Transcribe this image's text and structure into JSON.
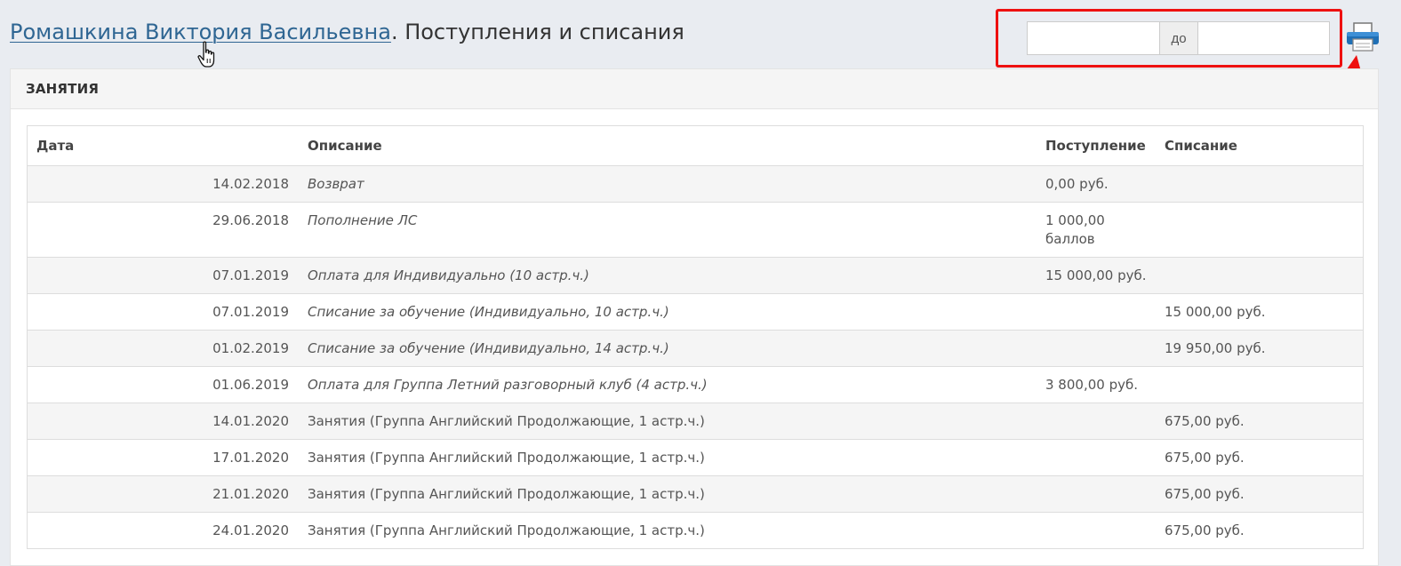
{
  "header": {
    "student_name": "Ромашкина Виктория Васильевна",
    "suffix": ". Поступления и списания"
  },
  "date_filter": {
    "from_value": "",
    "separator": "до",
    "to_value": ""
  },
  "icons": {
    "print": "printer-icon",
    "cursor": "hand-pointer-icon"
  },
  "colors": {
    "link": "#2f6693",
    "highlight": "#ee1010",
    "accent": "#1f6fb5"
  },
  "panel": {
    "title": "ЗАНЯТИЯ"
  },
  "table": {
    "columns": [
      "Дата",
      "Описание",
      "Поступление",
      "Списание"
    ],
    "rows": [
      {
        "date": "14.02.2018",
        "desc": "Возврат",
        "italic": true,
        "income": "0,00 руб.",
        "expense": ""
      },
      {
        "date": "29.06.2018",
        "desc": "Пополнение ЛС",
        "italic": true,
        "income": "1 000,00 баллов",
        "expense": ""
      },
      {
        "date": "07.01.2019",
        "desc": "Оплата для Индивидуально (10 астр.ч.)",
        "italic": true,
        "income": "15 000,00 руб.",
        "expense": ""
      },
      {
        "date": "07.01.2019",
        "desc": "Списание за обучение (Индивидуально, 10 астр.ч.)",
        "italic": true,
        "income": "",
        "expense": "15 000,00 руб."
      },
      {
        "date": "01.02.2019",
        "desc": "Списание за обучение (Индивидуально, 14 астр.ч.)",
        "italic": true,
        "income": "",
        "expense": "19 950,00 руб."
      },
      {
        "date": "01.06.2019",
        "desc": "Оплата для Группа Летний разговорный клуб (4 астр.ч.)",
        "italic": true,
        "income": "3 800,00 руб.",
        "expense": ""
      },
      {
        "date": "14.01.2020",
        "desc": "Занятия (Группа Английский Продолжающие, 1 астр.ч.)",
        "italic": false,
        "income": "",
        "expense": "675,00 руб."
      },
      {
        "date": "17.01.2020",
        "desc": "Занятия (Группа Английский Продолжающие, 1 астр.ч.)",
        "italic": false,
        "income": "",
        "expense": "675,00 руб."
      },
      {
        "date": "21.01.2020",
        "desc": "Занятия (Группа Английский Продолжающие, 1 астр.ч.)",
        "italic": false,
        "income": "",
        "expense": "675,00 руб."
      },
      {
        "date": "24.01.2020",
        "desc": "Занятия (Группа Английский Продолжающие, 1 астр.ч.)",
        "italic": false,
        "income": "",
        "expense": "675,00 руб."
      }
    ]
  }
}
